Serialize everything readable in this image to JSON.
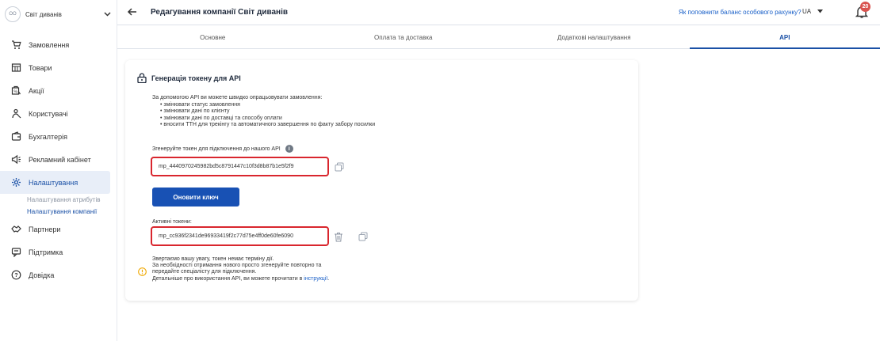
{
  "colors": {
    "accent": "#1a50a6",
    "primary_button": "#1851b4",
    "highlight_border": "#d9262e",
    "badge": "#d9534f",
    "warning": "#f0a800"
  },
  "company": {
    "avatar_text": "ОО",
    "name": "Світ диванів"
  },
  "sidebar": {
    "items": [
      {
        "label": "Замовлення",
        "icon": "cart-icon"
      },
      {
        "label": "Товари",
        "icon": "box-icon"
      },
      {
        "label": "Акції",
        "icon": "tag-icon"
      },
      {
        "label": "Користувачі",
        "icon": "users-icon"
      },
      {
        "label": "Бухгалтерія",
        "icon": "wallet-icon"
      },
      {
        "label": "Рекламний кабінет",
        "icon": "megaphone-icon"
      },
      {
        "label": "Налаштування",
        "icon": "gear-icon"
      }
    ],
    "subitems": [
      {
        "label": "Налаштування атрибутів"
      },
      {
        "label": "Налаштування компанії"
      }
    ],
    "items_after": [
      {
        "label": "Партнери",
        "icon": "handshake-icon"
      },
      {
        "label": "Підтримка",
        "icon": "chat-icon"
      },
      {
        "label": "Довідка",
        "icon": "help-icon"
      }
    ]
  },
  "header": {
    "title": "Редагування компанії Світ диванів",
    "help_link": "Як поповнити баланс особового рахунку?",
    "language": "UA",
    "notification_count": "20"
  },
  "tabs": [
    {
      "label": "Основне"
    },
    {
      "label": "Оплата та доставка"
    },
    {
      "label": "Додаткові налаштування"
    },
    {
      "label": "API"
    }
  ],
  "api_card": {
    "title": "Генерація токену для API",
    "intro": "За допомогою API ви можете швидко опрацьовувати замовлення:",
    "bullets": [
      "змінювати статус замовлення",
      "змінювати дані по клієнту",
      "змінювати дані по доставці та способу оплати",
      "вносити ТТН для трекінгу та автоматичного завершення по факту забору посилки"
    ],
    "generate_label": "Згенеруйте токен для підключення до нашого API",
    "generated_token": "mp_4440970245982bd5c8791447c10f3d8b87b1e5f2f9",
    "refresh_button": "Оновити ключ",
    "active_tokens_label": "Активні токени:",
    "active_token": "mp_cc936f2341de96933419f2c77d75e4ff0de60fe6090",
    "notice_line1": "Звертаємо вашу увагу, токен немає терміну дії.",
    "notice_line2": "За необхідності отримання нового просто згенеруйте повторно та",
    "notice_line3": "передайте спеціалісту для підключення.",
    "notice_line4_prefix": "Детальніше про використання API, ви можете прочитати в ",
    "notice_link": "інструкції",
    "notice_line4_suffix": "."
  }
}
